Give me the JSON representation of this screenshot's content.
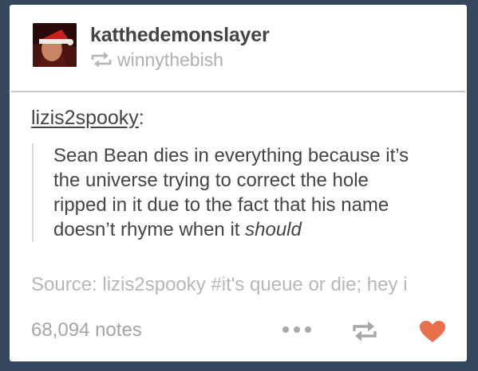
{
  "post": {
    "blog_name": "katthedemonslayer",
    "reblogged_from": "winnythebish",
    "source_username": "lizis2spooky",
    "source_suffix": ":",
    "quote_text_lines": [
      "Sean Bean dies in everything because it’s",
      "the universe trying to correct the hole",
      "ripped in it due to the fact that his name",
      "doesn’t rhyme when it "
    ],
    "quote_emphasis": "should",
    "source_line": "Source: lizis2spooky #it's queue or die; hey i",
    "notes": "68,094 notes"
  },
  "icons": {
    "reblog_small": "reblog-icon",
    "more": "ellipsis-icon",
    "reblog_action": "reblog-icon",
    "like": "heart-icon"
  },
  "colors": {
    "background": "#36465d",
    "card": "#ffffff",
    "text": "#444444",
    "muted": "#b0b0b0",
    "like": "#e8704a"
  }
}
